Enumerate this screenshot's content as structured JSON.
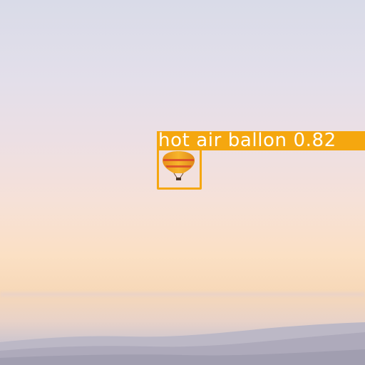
{
  "detection": {
    "label": "hot air ballon 0.82"
  },
  "colors": {
    "box": "#f5a70f",
    "label_text": "#ffffff",
    "balloon_body": "#f0a520",
    "balloon_stripe": "#d8452a",
    "sky_top": "#d9dbe8",
    "sky_horizon": "#fbe0c4",
    "hills": "#a9a6b7"
  }
}
